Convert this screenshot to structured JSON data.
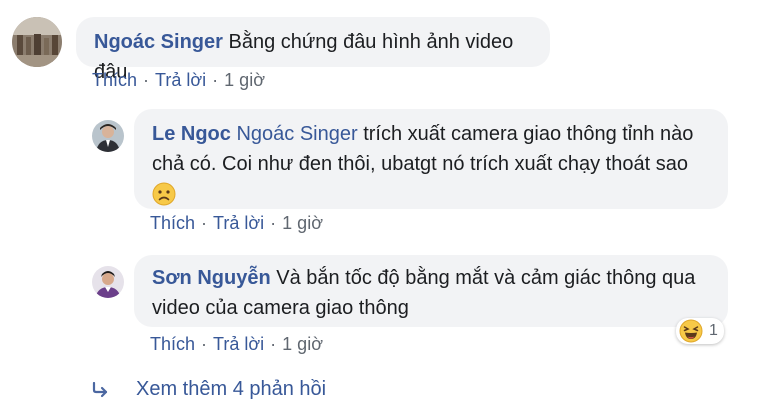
{
  "comments": [
    {
      "author": "Ngoác Singer",
      "text": "Bằng chứng đâu hình ảnh video đâu",
      "actions": {
        "like": "Thích",
        "reply": "Trả lời",
        "time": "1 giờ",
        "sep": "·"
      }
    },
    {
      "author": "Le Ngoc",
      "mention": "Ngoác Singer",
      "line1": "trích xuất camera giao thông tỉnh nào",
      "line2": "chả có. Coi như đen thôi, ubatgt nó trích xuất chạy thoát sao",
      "emoji": "frowning-face",
      "actions": {
        "like": "Thích",
        "reply": "Trả lời",
        "time": "1 giờ",
        "sep": "·"
      }
    },
    {
      "author": "Sơn Nguyễn",
      "line1": "Và bắn tốc độ bằng mắt và cảm giác thông qua",
      "line2": "video của camera giao thông",
      "reaction_count": "1",
      "reaction_icon": "laughing-face",
      "actions": {
        "like": "Thích",
        "reply": "Trả lời",
        "time": "1 giờ",
        "sep": "·"
      }
    }
  ],
  "more_replies": "Xem thêm 4 phản hồi",
  "colors": {
    "link": "#385898",
    "bubble": "#f2f3f5",
    "meta": "#606770"
  }
}
